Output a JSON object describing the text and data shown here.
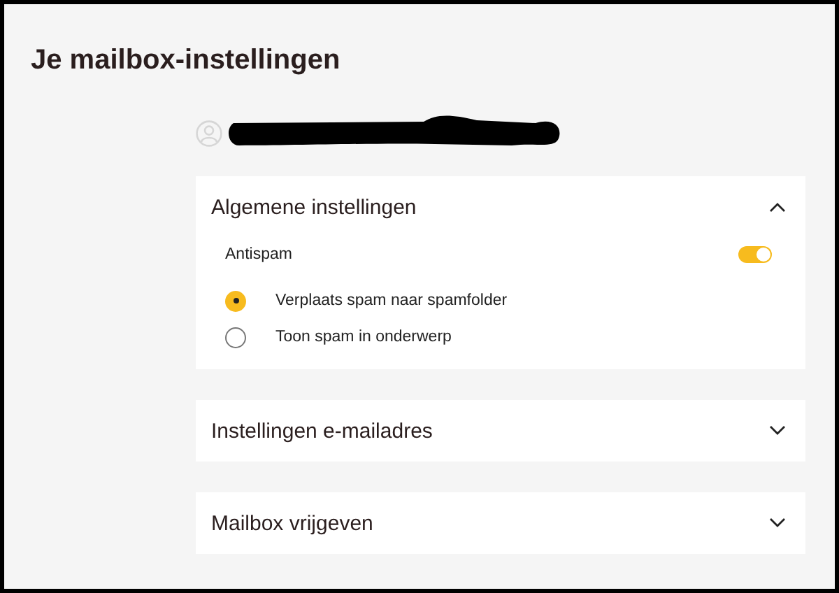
{
  "title": "Je mailbox-instellingen",
  "sections": [
    {
      "title": "Algemene instellingen",
      "expanded": true,
      "toggle": {
        "label": "Antispam",
        "on": true
      },
      "options": [
        {
          "label": "Verplaats spam naar spamfolder",
          "selected": true
        },
        {
          "label": "Toon spam in onderwerp",
          "selected": false
        }
      ]
    },
    {
      "title": "Instellingen e-mailadres",
      "expanded": false
    },
    {
      "title": "Mailbox vrijgeven",
      "expanded": false
    }
  ]
}
